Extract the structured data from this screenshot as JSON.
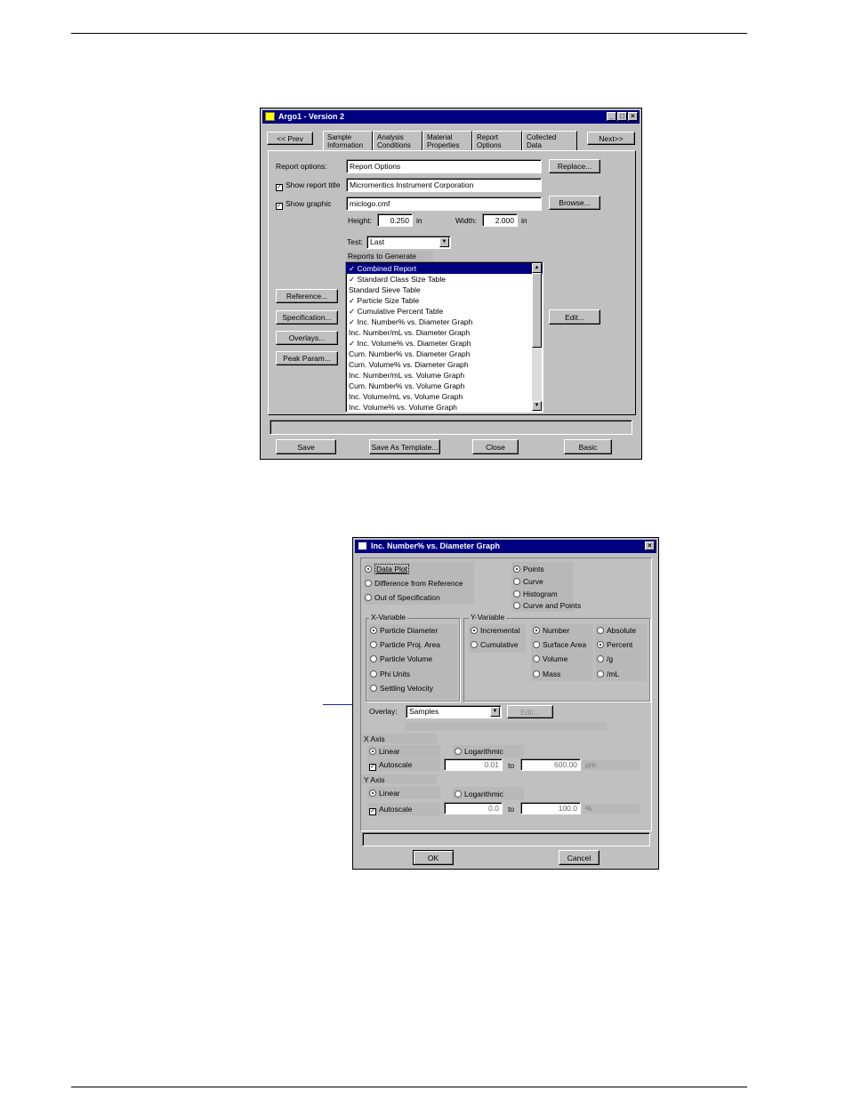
{
  "win1": {
    "title": "Argo1   - Version 2",
    "prev": "<< Prev",
    "next": "Next>>",
    "tabs": [
      {
        "l1": "Sample",
        "l2": "Information"
      },
      {
        "l1": "Analysis",
        "l2": "Conditions"
      },
      {
        "l1": "Material",
        "l2": "Properties"
      },
      {
        "l1": "Report",
        "l2": "Options"
      },
      {
        "l1": "Collected",
        "l2": "Data"
      }
    ],
    "report_options_label": "Report options:",
    "report_options_value": "Report Options",
    "replace": "Replace...",
    "show_report_title": "Show report title",
    "report_title_value": "Micromeritics Instrument Corporation",
    "show_graphic": "Show graphic",
    "graphic_value": "miclogo.cmf",
    "browse": "Browse...",
    "height_label": "Height:",
    "height_value": "0.250",
    "in1": "in",
    "width_label": "Width:",
    "width_value": "2.000",
    "in2": "in",
    "test_label": "Test:",
    "test_value": "Last",
    "reports_header": "Reports to Generate",
    "reports": [
      "✓ Combined Report",
      "✓ Standard Class Size Table",
      "   Standard Sieve Table",
      "✓ Particle Size Table",
      "✓ Cumulative Percent Table",
      "✓ Inc. Number% vs. Diameter Graph",
      "   Inc. Number/mL vs. Diameter Graph",
      "✓ Inc. Volume% vs. Diameter Graph",
      "   Cum. Number% vs. Diameter Graph",
      "   Cum. Volume% vs. Diameter Graph",
      "   Inc. Number/mL vs. Volume Graph",
      "   Cum. Number% vs. Volume Graph",
      "   Inc. Volume/mL vs. Volume Graph",
      "   Inc. Volume% vs. Volume Graph"
    ],
    "reference": "Reference...",
    "specification": "Specification...",
    "overlays": "Overlays...",
    "peak_param": "Peak Param...",
    "edit": "Edit...",
    "save": "Save",
    "save_template": "Save As Template...",
    "close": "Close",
    "basic": "Basic"
  },
  "win2": {
    "title": "Inc. Number% vs. Diameter Graph",
    "plot_modes": [
      "Data Plot",
      "Difference from Reference",
      "Out of Specification"
    ],
    "plot_styles": [
      "Points",
      "Curve",
      "Histogram",
      "Curve and Points"
    ],
    "x_var_label": "X-Variable",
    "x_vars": [
      "Particle Diameter",
      "Particle Proj. Area",
      "Particle Volume",
      "Phi Units",
      "Settling Velocity"
    ],
    "y_var_label": "Y-Variable",
    "y_modes": [
      "Incremental",
      "Cumulative"
    ],
    "y_quantities": [
      "Number",
      "Surface Area",
      "Volume",
      "Mass"
    ],
    "y_units": [
      "Absolute",
      "Percent",
      "/g",
      "/mL"
    ],
    "overlay_label": "Overlay:",
    "overlay_value": "Samples",
    "edit": "Edit...",
    "x_axis_label": "X Axis",
    "x_linear": "Linear",
    "x_log": "Logarithmic",
    "x_autoscale": "Autoscale",
    "x_min": "0.01",
    "x_to": "to",
    "x_max": "600.00",
    "x_unit": "µm",
    "y_axis_label": "Y Axis",
    "y_linear": "Linear",
    "y_log": "Logarithmic",
    "y_autoscale": "Autoscale",
    "y_min": "0.0",
    "y_to": "to",
    "y_max": "100.0",
    "y_unit": "%",
    "ok": "OK",
    "cancel": "Cancel"
  }
}
